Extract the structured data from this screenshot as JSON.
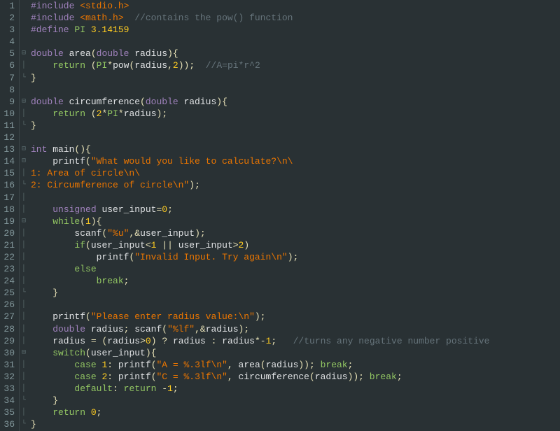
{
  "lines": [
    {
      "n": "1",
      "fold": "",
      "tokens": [
        {
          "c": "pp",
          "t": "#include "
        },
        {
          "c": "str",
          "t": "<stdio.h>"
        }
      ]
    },
    {
      "n": "2",
      "fold": "",
      "tokens": [
        {
          "c": "pp",
          "t": "#include "
        },
        {
          "c": "str",
          "t": "<math.h>"
        },
        {
          "c": "id",
          "t": "  "
        },
        {
          "c": "cmt",
          "t": "//contains the pow() function"
        }
      ]
    },
    {
      "n": "3",
      "fold": "",
      "tokens": [
        {
          "c": "pp",
          "t": "#define "
        },
        {
          "c": "const",
          "t": "PI "
        },
        {
          "c": "num",
          "t": "3.14159"
        }
      ]
    },
    {
      "n": "4",
      "fold": "",
      "tokens": []
    },
    {
      "n": "5",
      "fold": "⊟",
      "tokens": [
        {
          "c": "type",
          "t": "double"
        },
        {
          "c": "id",
          "t": " area"
        },
        {
          "c": "op",
          "t": "("
        },
        {
          "c": "type",
          "t": "double"
        },
        {
          "c": "id",
          "t": " radius"
        },
        {
          "c": "op",
          "t": "){"
        }
      ]
    },
    {
      "n": "6",
      "fold": "│",
      "tokens": [
        {
          "c": "id",
          "t": "    "
        },
        {
          "c": "kw",
          "t": "return"
        },
        {
          "c": "id",
          "t": " "
        },
        {
          "c": "op",
          "t": "("
        },
        {
          "c": "const",
          "t": "PI"
        },
        {
          "c": "op",
          "t": "*"
        },
        {
          "c": "id",
          "t": "pow"
        },
        {
          "c": "op",
          "t": "("
        },
        {
          "c": "id",
          "t": "radius"
        },
        {
          "c": "op",
          "t": ","
        },
        {
          "c": "num",
          "t": "2"
        },
        {
          "c": "op",
          "t": "));"
        },
        {
          "c": "id",
          "t": "  "
        },
        {
          "c": "cmt",
          "t": "//A=pi*r^2"
        }
      ]
    },
    {
      "n": "7",
      "fold": "└",
      "tokens": [
        {
          "c": "op",
          "t": "}"
        }
      ]
    },
    {
      "n": "8",
      "fold": "",
      "tokens": []
    },
    {
      "n": "9",
      "fold": "⊟",
      "tokens": [
        {
          "c": "type",
          "t": "double"
        },
        {
          "c": "id",
          "t": " circumference"
        },
        {
          "c": "op",
          "t": "("
        },
        {
          "c": "type",
          "t": "double"
        },
        {
          "c": "id",
          "t": " radius"
        },
        {
          "c": "op",
          "t": "){"
        }
      ]
    },
    {
      "n": "10",
      "fold": "│",
      "tokens": [
        {
          "c": "id",
          "t": "    "
        },
        {
          "c": "kw",
          "t": "return"
        },
        {
          "c": "id",
          "t": " "
        },
        {
          "c": "op",
          "t": "("
        },
        {
          "c": "num",
          "t": "2"
        },
        {
          "c": "op",
          "t": "*"
        },
        {
          "c": "const",
          "t": "PI"
        },
        {
          "c": "op",
          "t": "*"
        },
        {
          "c": "id",
          "t": "radius"
        },
        {
          "c": "op",
          "t": ");"
        }
      ]
    },
    {
      "n": "11",
      "fold": "└",
      "tokens": [
        {
          "c": "op",
          "t": "}"
        }
      ]
    },
    {
      "n": "12",
      "fold": "",
      "tokens": []
    },
    {
      "n": "13",
      "fold": "⊟",
      "tokens": [
        {
          "c": "type",
          "t": "int"
        },
        {
          "c": "id",
          "t": " main"
        },
        {
          "c": "op",
          "t": "(){"
        }
      ]
    },
    {
      "n": "14",
      "fold": "⊟",
      "tokens": [
        {
          "c": "id",
          "t": "    printf"
        },
        {
          "c": "op",
          "t": "("
        },
        {
          "c": "str",
          "t": "\"What would you like to calculate?\\n\\"
        }
      ]
    },
    {
      "n": "15",
      "fold": "│",
      "tokens": [
        {
          "c": "str",
          "t": "1: Area of circle\\n\\"
        }
      ]
    },
    {
      "n": "16",
      "fold": "└",
      "tokens": [
        {
          "c": "str",
          "t": "2: Circumference of circle\\n\""
        },
        {
          "c": "op",
          "t": ");"
        }
      ]
    },
    {
      "n": "17",
      "fold": "│",
      "tokens": []
    },
    {
      "n": "18",
      "fold": "│",
      "tokens": [
        {
          "c": "id",
          "t": "    "
        },
        {
          "c": "type",
          "t": "unsigned"
        },
        {
          "c": "id",
          "t": " user_input"
        },
        {
          "c": "op",
          "t": "="
        },
        {
          "c": "num",
          "t": "0"
        },
        {
          "c": "op",
          "t": ";"
        }
      ]
    },
    {
      "n": "19",
      "fold": "⊟",
      "tokens": [
        {
          "c": "id",
          "t": "    "
        },
        {
          "c": "kw",
          "t": "while"
        },
        {
          "c": "op",
          "t": "("
        },
        {
          "c": "num",
          "t": "1"
        },
        {
          "c": "op",
          "t": "){"
        }
      ]
    },
    {
      "n": "20",
      "fold": "│",
      "tokens": [
        {
          "c": "id",
          "t": "        scanf"
        },
        {
          "c": "op",
          "t": "("
        },
        {
          "c": "str",
          "t": "\"%u\""
        },
        {
          "c": "op",
          "t": ",&"
        },
        {
          "c": "id",
          "t": "user_input"
        },
        {
          "c": "op",
          "t": ");"
        }
      ]
    },
    {
      "n": "21",
      "fold": "│",
      "tokens": [
        {
          "c": "id",
          "t": "        "
        },
        {
          "c": "kw",
          "t": "if"
        },
        {
          "c": "op",
          "t": "("
        },
        {
          "c": "id",
          "t": "user_input"
        },
        {
          "c": "op",
          "t": "<"
        },
        {
          "c": "num",
          "t": "1"
        },
        {
          "c": "id",
          "t": " "
        },
        {
          "c": "op",
          "t": "||"
        },
        {
          "c": "id",
          "t": " user_input"
        },
        {
          "c": "op",
          "t": ">"
        },
        {
          "c": "num",
          "t": "2"
        },
        {
          "c": "op",
          "t": ")"
        }
      ]
    },
    {
      "n": "22",
      "fold": "│",
      "tokens": [
        {
          "c": "id",
          "t": "            printf"
        },
        {
          "c": "op",
          "t": "("
        },
        {
          "c": "str",
          "t": "\"Invalid Input. Try again\\n\""
        },
        {
          "c": "op",
          "t": ");"
        }
      ]
    },
    {
      "n": "23",
      "fold": "│",
      "tokens": [
        {
          "c": "id",
          "t": "        "
        },
        {
          "c": "kw",
          "t": "else"
        }
      ]
    },
    {
      "n": "24",
      "fold": "│",
      "tokens": [
        {
          "c": "id",
          "t": "            "
        },
        {
          "c": "kw",
          "t": "break"
        },
        {
          "c": "op",
          "t": ";"
        }
      ]
    },
    {
      "n": "25",
      "fold": "└",
      "tokens": [
        {
          "c": "id",
          "t": "    "
        },
        {
          "c": "op",
          "t": "}"
        }
      ]
    },
    {
      "n": "26",
      "fold": "│",
      "tokens": []
    },
    {
      "n": "27",
      "fold": "│",
      "tokens": [
        {
          "c": "id",
          "t": "    printf"
        },
        {
          "c": "op",
          "t": "("
        },
        {
          "c": "str",
          "t": "\"Please enter radius value:\\n\""
        },
        {
          "c": "op",
          "t": ");"
        }
      ]
    },
    {
      "n": "28",
      "fold": "│",
      "tokens": [
        {
          "c": "id",
          "t": "    "
        },
        {
          "c": "type",
          "t": "double"
        },
        {
          "c": "id",
          "t": " radius"
        },
        {
          "c": "op",
          "t": ";"
        },
        {
          "c": "id",
          "t": " scanf"
        },
        {
          "c": "op",
          "t": "("
        },
        {
          "c": "str",
          "t": "\"%lf\""
        },
        {
          "c": "op",
          "t": ",&"
        },
        {
          "c": "id",
          "t": "radius"
        },
        {
          "c": "op",
          "t": ");"
        }
      ]
    },
    {
      "n": "29",
      "fold": "│",
      "tokens": [
        {
          "c": "id",
          "t": "    radius "
        },
        {
          "c": "op",
          "t": "="
        },
        {
          "c": "id",
          "t": " "
        },
        {
          "c": "op",
          "t": "("
        },
        {
          "c": "id",
          "t": "radius"
        },
        {
          "c": "op",
          "t": ">"
        },
        {
          "c": "num",
          "t": "0"
        },
        {
          "c": "op",
          "t": ")"
        },
        {
          "c": "id",
          "t": " "
        },
        {
          "c": "op",
          "t": "?"
        },
        {
          "c": "id",
          "t": " radius "
        },
        {
          "c": "op",
          "t": ":"
        },
        {
          "c": "id",
          "t": " radius"
        },
        {
          "c": "op",
          "t": "*-"
        },
        {
          "c": "num",
          "t": "1"
        },
        {
          "c": "op",
          "t": ";"
        },
        {
          "c": "id",
          "t": "   "
        },
        {
          "c": "cmt",
          "t": "//turns any negative number positive"
        }
      ]
    },
    {
      "n": "30",
      "fold": "⊟",
      "tokens": [
        {
          "c": "id",
          "t": "    "
        },
        {
          "c": "kw",
          "t": "switch"
        },
        {
          "c": "op",
          "t": "("
        },
        {
          "c": "id",
          "t": "user_input"
        },
        {
          "c": "op",
          "t": "){"
        }
      ]
    },
    {
      "n": "31",
      "fold": "│",
      "tokens": [
        {
          "c": "id",
          "t": "        "
        },
        {
          "c": "kw",
          "t": "case"
        },
        {
          "c": "id",
          "t": " "
        },
        {
          "c": "num",
          "t": "1"
        },
        {
          "c": "op",
          "t": ":"
        },
        {
          "c": "id",
          "t": " printf"
        },
        {
          "c": "op",
          "t": "("
        },
        {
          "c": "str",
          "t": "\"A = %.3lf\\n\""
        },
        {
          "c": "op",
          "t": ","
        },
        {
          "c": "id",
          "t": " area"
        },
        {
          "c": "op",
          "t": "("
        },
        {
          "c": "id",
          "t": "radius"
        },
        {
          "c": "op",
          "t": "));"
        },
        {
          "c": "id",
          "t": " "
        },
        {
          "c": "kw",
          "t": "break"
        },
        {
          "c": "op",
          "t": ";"
        }
      ]
    },
    {
      "n": "32",
      "fold": "│",
      "tokens": [
        {
          "c": "id",
          "t": "        "
        },
        {
          "c": "kw",
          "t": "case"
        },
        {
          "c": "id",
          "t": " "
        },
        {
          "c": "num",
          "t": "2"
        },
        {
          "c": "op",
          "t": ":"
        },
        {
          "c": "id",
          "t": " printf"
        },
        {
          "c": "op",
          "t": "("
        },
        {
          "c": "str",
          "t": "\"C = %.3lf\\n\""
        },
        {
          "c": "op",
          "t": ","
        },
        {
          "c": "id",
          "t": " circumference"
        },
        {
          "c": "op",
          "t": "("
        },
        {
          "c": "id",
          "t": "radius"
        },
        {
          "c": "op",
          "t": "));"
        },
        {
          "c": "id",
          "t": " "
        },
        {
          "c": "kw",
          "t": "break"
        },
        {
          "c": "op",
          "t": ";"
        }
      ]
    },
    {
      "n": "33",
      "fold": "│",
      "tokens": [
        {
          "c": "id",
          "t": "        "
        },
        {
          "c": "kw",
          "t": "default"
        },
        {
          "c": "op",
          "t": ":"
        },
        {
          "c": "id",
          "t": " "
        },
        {
          "c": "kw",
          "t": "return"
        },
        {
          "c": "id",
          "t": " "
        },
        {
          "c": "op",
          "t": "-"
        },
        {
          "c": "num",
          "t": "1"
        },
        {
          "c": "op",
          "t": ";"
        }
      ]
    },
    {
      "n": "34",
      "fold": "└",
      "tokens": [
        {
          "c": "id",
          "t": "    "
        },
        {
          "c": "op",
          "t": "}"
        }
      ]
    },
    {
      "n": "35",
      "fold": "│",
      "tokens": [
        {
          "c": "id",
          "t": "    "
        },
        {
          "c": "kw",
          "t": "return"
        },
        {
          "c": "id",
          "t": " "
        },
        {
          "c": "num",
          "t": "0"
        },
        {
          "c": "op",
          "t": ";"
        }
      ]
    },
    {
      "n": "36",
      "fold": "└",
      "tokens": [
        {
          "c": "op",
          "t": "}"
        }
      ]
    }
  ]
}
